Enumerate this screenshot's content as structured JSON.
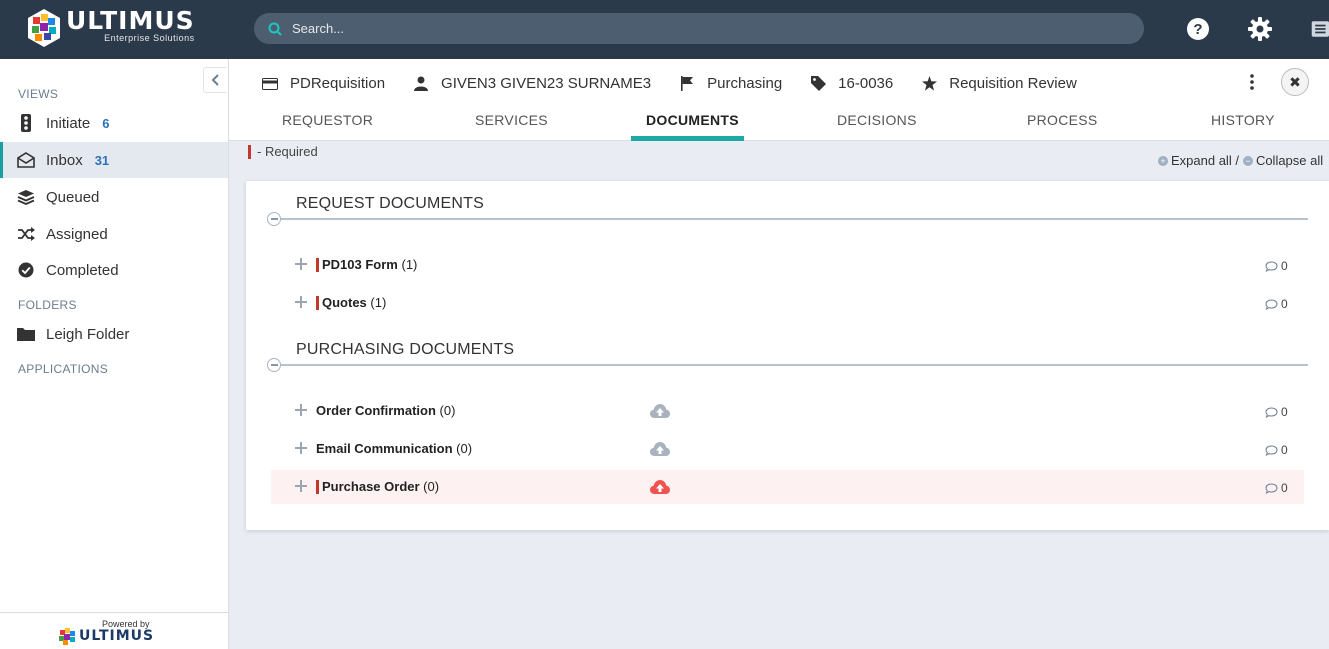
{
  "app": {
    "logo_name": "ULTIMUS",
    "logo_tagline": "Enterprise Solutions",
    "search_placeholder": "Search...",
    "accent_color": "#1aa9a3"
  },
  "sidebar": {
    "views_title": "VIEWS",
    "views": [
      {
        "label": "Initiate",
        "count": "6",
        "icon": "traffic-light-icon"
      },
      {
        "label": "Inbox",
        "count": "31",
        "icon": "inbox-icon",
        "active": true
      },
      {
        "label": "Queued",
        "icon": "layers-icon"
      },
      {
        "label": "Assigned",
        "icon": "shuffle-icon"
      },
      {
        "label": "Completed",
        "icon": "check-circle-icon"
      }
    ],
    "folders_title": "FOLDERS",
    "folders": [
      {
        "label": "Leigh Folder",
        "icon": "folder-icon"
      }
    ],
    "applications_title": "APPLICATIONS",
    "powered_by": "Powered by",
    "footer_logo": "ULTIMUS"
  },
  "header": {
    "process": "PDRequisition",
    "user": "GIVEN3 GIVEN23 SURNAME3",
    "department": "Purchasing",
    "number": "16-0036",
    "step": "Requisition Review",
    "close_label": "✖"
  },
  "tabs": [
    "REQUESTOR",
    "SERVICES",
    "DOCUMENTS",
    "DECISIONS",
    "PROCESS",
    "HISTORY"
  ],
  "active_tab": "DOCUMENTS",
  "content": {
    "required_legend": "- Required",
    "expand_all": "Expand all /",
    "collapse_all": "Collapse all",
    "groups": [
      {
        "title": "REQUEST DOCUMENTS",
        "docs": [
          {
            "name": "PD103 Form",
            "count": "(1)",
            "comments": "0",
            "required": true
          },
          {
            "name": "Quotes",
            "count": "(1)",
            "comments": "0",
            "required": true
          }
        ]
      },
      {
        "title": "PURCHASING DOCUMENTS",
        "docs": [
          {
            "name": "Order Confirmation",
            "count": "(0)",
            "comments": "0",
            "required": false,
            "upload": "grey"
          },
          {
            "name": "Email Communication",
            "count": "(0)",
            "comments": "0",
            "required": false,
            "upload": "grey"
          },
          {
            "name": "Purchase Order",
            "count": "(0)",
            "comments": "0",
            "required": true,
            "upload": "red"
          }
        ]
      }
    ]
  }
}
